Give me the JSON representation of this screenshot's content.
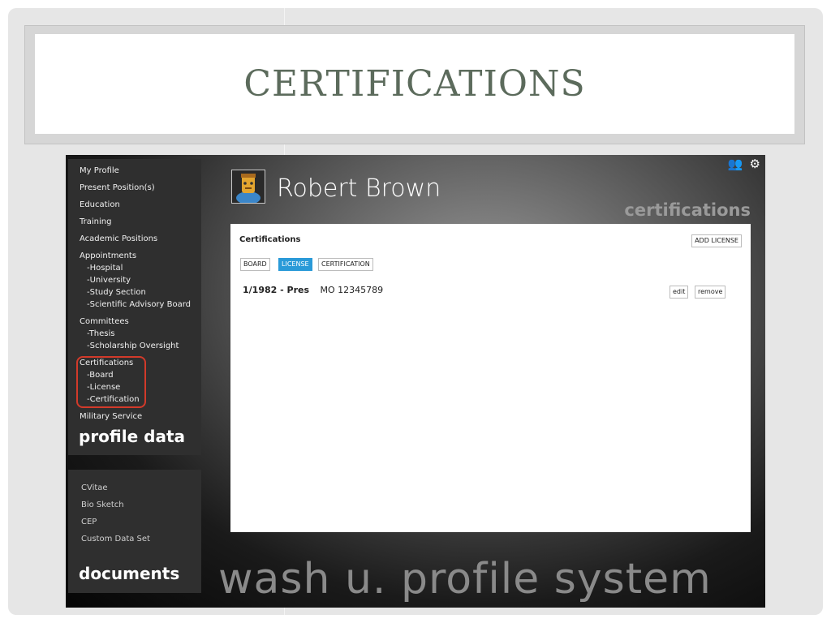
{
  "slide": {
    "title": "CERTIFICATIONS"
  },
  "app": {
    "sidebar": {
      "items": [
        {
          "label": "My Profile"
        },
        {
          "label": "Present Position(s)"
        },
        {
          "label": "Education"
        },
        {
          "label": "Training"
        },
        {
          "label": "Academic Positions"
        },
        {
          "label": "Appointments"
        },
        {
          "label": "-Hospital"
        },
        {
          "label": "-University"
        },
        {
          "label": "-Study Section"
        },
        {
          "label": "-Scientific Advisory Board"
        },
        {
          "label": "Committees"
        },
        {
          "label": "-Thesis"
        },
        {
          "label": "-Scholarship Oversight"
        },
        {
          "label": "Certifications"
        },
        {
          "label": "-Board"
        },
        {
          "label": "-License"
        },
        {
          "label": "-Certification"
        },
        {
          "label": "Military Service"
        }
      ],
      "section_label": "profile data"
    },
    "documents": {
      "items": [
        {
          "label": "CVitae"
        },
        {
          "label": "Bio Sketch"
        },
        {
          "label": "CEP"
        },
        {
          "label": "Custom Data Set"
        }
      ],
      "section_label": "documents"
    },
    "header": {
      "user_name": "Robert Brown",
      "page_label": "certifications",
      "icons": [
        "people-icon",
        "gear-icon"
      ]
    },
    "panel": {
      "title": "Certifications",
      "add_button": "ADD LICENSE",
      "tabs": [
        {
          "label": "BOARD",
          "active": false
        },
        {
          "label": "LICENSE",
          "active": true
        },
        {
          "label": "CERTIFICATION",
          "active": false
        }
      ],
      "rows": [
        {
          "date": "1/1982 - Pres",
          "number": "MO 12345789",
          "edit_label": "edit",
          "remove_label": "remove"
        }
      ]
    },
    "footer_text": "wash u. profile system",
    "colors": {
      "accent": "#2a9ad8",
      "highlight": "#d23a2a",
      "title": "#5c6b5c"
    }
  }
}
